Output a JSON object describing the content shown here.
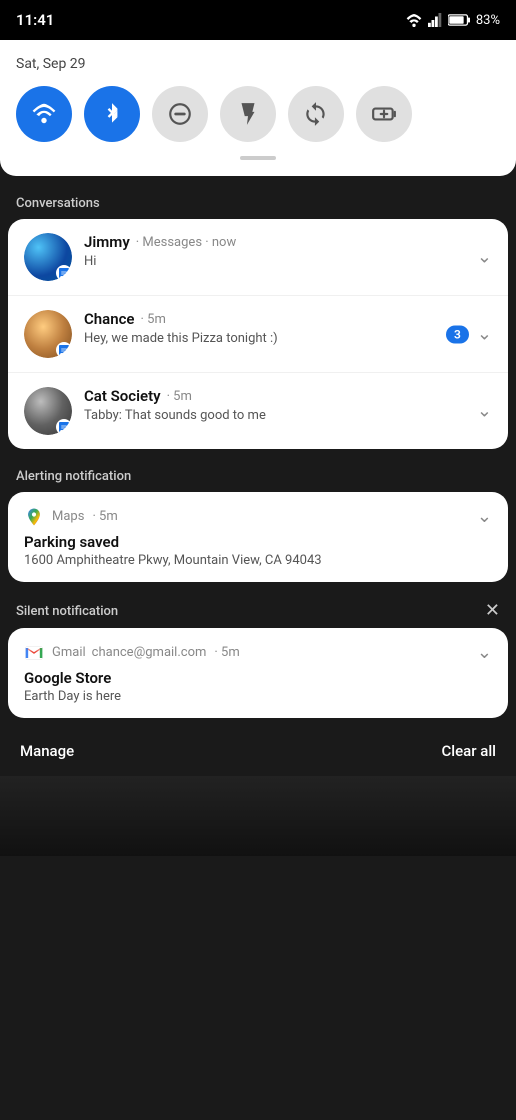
{
  "statusBar": {
    "time": "11:41",
    "battery": "83%"
  },
  "quickSettings": {
    "date": "Sat, Sep 29",
    "buttons": [
      {
        "id": "wifi",
        "label": "WiFi",
        "active": true,
        "icon": "wifi"
      },
      {
        "id": "bluetooth",
        "label": "Bluetooth",
        "active": true,
        "icon": "bluetooth"
      },
      {
        "id": "dnd",
        "label": "Do Not Disturb",
        "active": false,
        "icon": "minus-circle"
      },
      {
        "id": "flashlight",
        "label": "Flashlight",
        "active": false,
        "icon": "flashlight"
      },
      {
        "id": "rotate",
        "label": "Auto Rotate",
        "active": false,
        "icon": "rotate"
      },
      {
        "id": "battery-saver",
        "label": "Battery Saver",
        "active": false,
        "icon": "battery-plus"
      }
    ]
  },
  "sections": {
    "conversations": {
      "label": "Conversations",
      "items": [
        {
          "id": "jimmy",
          "name": "Jimmy",
          "app": "Messages",
          "time": "now",
          "message": "Hi",
          "badge": null
        },
        {
          "id": "chance",
          "name": "Chance",
          "app": "",
          "time": "5m",
          "message": "Hey, we made this Pizza tonight :)",
          "badge": "3"
        },
        {
          "id": "cat-society",
          "name": "Cat Society",
          "app": "",
          "time": "5m",
          "message": "Tabby: That sounds good to me",
          "badge": null
        }
      ]
    },
    "alerting": {
      "label": "Alerting notification",
      "items": [
        {
          "id": "maps",
          "app": "Maps",
          "time": "5m",
          "title": "Parking saved",
          "body": "1600 Amphitheatre Pkwy, Mountain View, CA 94043"
        }
      ]
    },
    "silent": {
      "label": "Silent notification",
      "items": [
        {
          "id": "gmail",
          "app": "Gmail",
          "email": "chance@gmail.com",
          "time": "5m",
          "title": "Google Store",
          "body": "Earth Day is here"
        }
      ]
    }
  },
  "bottomBar": {
    "manage": "Manage",
    "clearAll": "Clear all"
  }
}
